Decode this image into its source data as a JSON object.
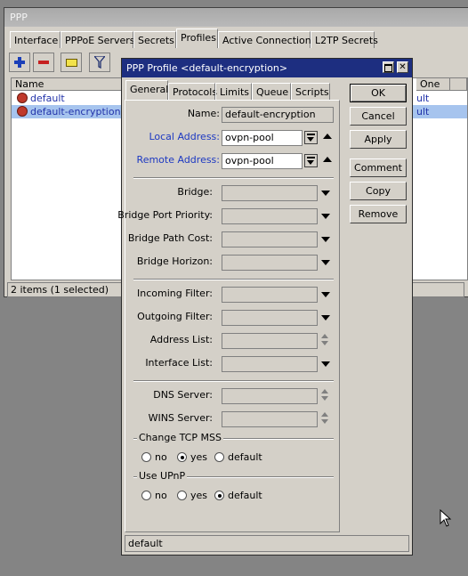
{
  "ppp": {
    "title": "PPP",
    "tabs": [
      "Interface",
      "PPPoE Servers",
      "Secrets",
      "Profiles",
      "Active Connections",
      "L2TP Secrets"
    ],
    "selected_tab": "Profiles",
    "list": {
      "columns": [
        "Name",
        "One"
      ],
      "rows": [
        {
          "name": "default",
          "only_one": "ult",
          "selected": false
        },
        {
          "name": "default-encryption",
          "only_one": "ult",
          "selected": true
        }
      ]
    },
    "status": "2 items (1 selected)"
  },
  "dialog": {
    "title": "PPP Profile <default-encryption>",
    "tabs": [
      "General",
      "Protocols",
      "Limits",
      "Queue",
      "Scripts"
    ],
    "selected_tab": "General",
    "fields": {
      "name": {
        "label": "Name:",
        "value": "default-encryption"
      },
      "local_address": {
        "label": "Local Address:",
        "value": "ovpn-pool"
      },
      "remote_address": {
        "label": "Remote Address:",
        "value": "ovpn-pool"
      },
      "bridge": {
        "label": "Bridge:",
        "value": ""
      },
      "bridge_port_priority": {
        "label": "Bridge Port Priority:",
        "value": ""
      },
      "bridge_path_cost": {
        "label": "Bridge Path Cost:",
        "value": ""
      },
      "bridge_horizon": {
        "label": "Bridge Horizon:",
        "value": ""
      },
      "incoming_filter": {
        "label": "Incoming Filter:",
        "value": ""
      },
      "outgoing_filter": {
        "label": "Outgoing Filter:",
        "value": ""
      },
      "address_list": {
        "label": "Address List:",
        "value": ""
      },
      "interface_list": {
        "label": "Interface List:",
        "value": ""
      },
      "dns_server": {
        "label": "DNS Server:",
        "value": ""
      },
      "wins_server": {
        "label": "WINS Server:",
        "value": ""
      }
    },
    "change_tcp_mss": {
      "label": "Change TCP MSS",
      "options": [
        "no",
        "yes",
        "default"
      ],
      "selected": "yes"
    },
    "use_upnp": {
      "label": "Use UPnP",
      "options": [
        "no",
        "yes",
        "default"
      ],
      "selected": "default"
    },
    "buttons": [
      "OK",
      "Cancel",
      "Apply",
      "Comment",
      "Copy",
      "Remove"
    ],
    "status": "default"
  },
  "colors": {
    "title_active": "#1d2e80",
    "link_blue": "#1c38c2",
    "selection": "#a6c4ee"
  }
}
